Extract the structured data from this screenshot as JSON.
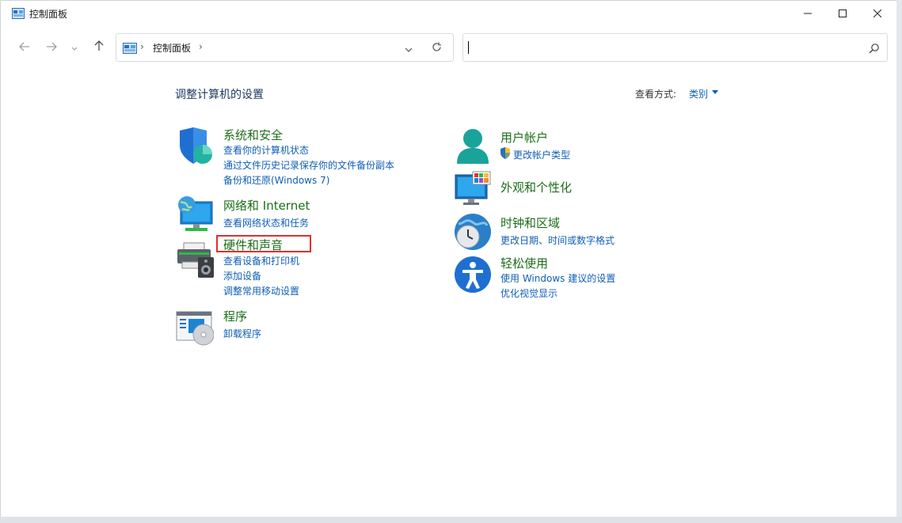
{
  "window": {
    "title": "控制面板",
    "controls": [
      "minimize",
      "maximize",
      "close"
    ]
  },
  "navigation": {
    "back_icon": "arrow-left-icon",
    "forward_icon": "arrow-right-icon",
    "recent_icon": "chevron-down-icon",
    "up_icon": "arrow-up-icon"
  },
  "address": {
    "separator": "›",
    "path": "控制面板",
    "trailing_separator": "›"
  },
  "search": {
    "value": "",
    "placeholder": ""
  },
  "main": {
    "heading": "调整计算机的设置",
    "view_by_label": "查看方式:",
    "view_by_value": "类别"
  },
  "categories": [
    {
      "icon": "security-shield-icon",
      "title": "系统和安全",
      "links": [
        "查看你的计算机状态",
        "通过文件历史记录保存你的文件备份副本",
        "备份和还原(Windows 7)"
      ]
    },
    {
      "icon": "network-globe-icon",
      "title": "网络和 Internet",
      "links": [
        "查看网络状态和任务"
      ]
    },
    {
      "icon": "printer-speaker-icon",
      "title": "硬件和声音",
      "links": [
        "查看设备和打印机",
        "添加设备",
        "调整常用移动设置"
      ],
      "highlighted": true
    },
    {
      "icon": "programs-disc-icon",
      "title": "程序",
      "links": [
        "卸载程序"
      ]
    },
    {
      "icon": "user-account-icon",
      "title": "用户帐户",
      "links": [
        "更改帐户类型"
      ],
      "link_icon": "uac-shield-icon"
    },
    {
      "icon": "monitor-palette-icon",
      "title": "外观和个性化",
      "links": []
    },
    {
      "icon": "clock-globe-icon",
      "title": "时钟和区域",
      "links": [
        "更改日期、时间或数字格式"
      ]
    },
    {
      "icon": "accessibility-icon",
      "title": "轻松使用",
      "links": [
        "使用 Windows 建议的设置",
        "优化视觉显示"
      ]
    }
  ],
  "colors": {
    "category_title": "#1b6e18",
    "link": "#0f5fb5",
    "heading": "#1e3a63",
    "highlight_box": "#e0312b"
  }
}
